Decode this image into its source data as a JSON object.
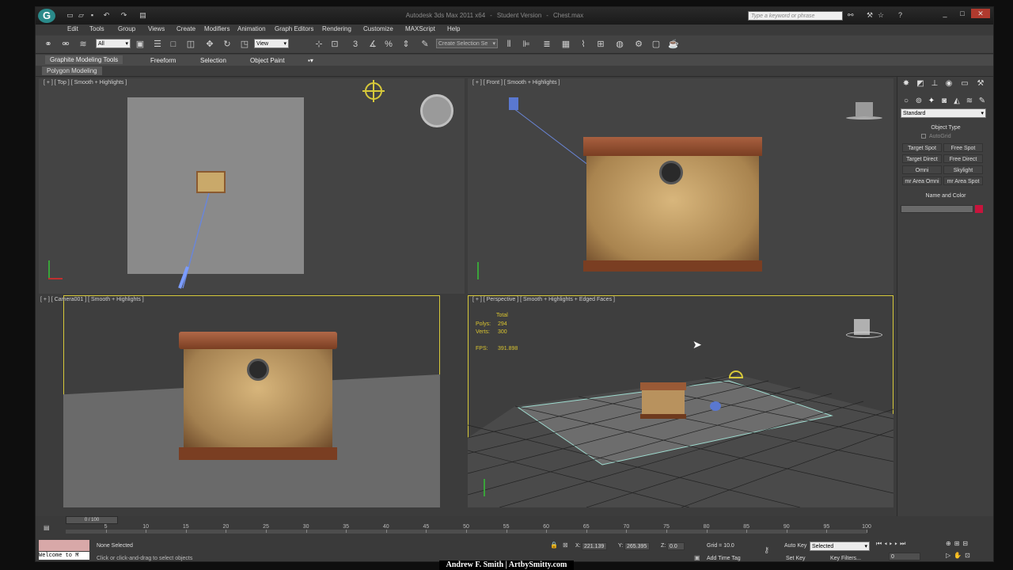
{
  "window": {
    "title_parts": [
      "Autodesk 3ds Max 2011 x64",
      "-",
      "Student Version",
      "-",
      "Chest.max"
    ],
    "search_placeholder": "Type a keyword or phrase",
    "controls": [
      "_",
      "□",
      "✕"
    ]
  },
  "menu": [
    "Edit",
    "Tools",
    "Group",
    "Views",
    "Create",
    "Modifiers",
    "Animation",
    "Graph Editors",
    "Rendering",
    "Customize",
    "MAXScript",
    "Help"
  ],
  "toolbar": {
    "filter_value": "All",
    "refcoord_value": "View",
    "selection_set_placeholder": "Create Selection Se"
  },
  "ribbon": {
    "tabs": [
      "Graphite Modeling Tools",
      "Freeform",
      "Selection",
      "Object Paint"
    ],
    "subtab": "Polygon Modeling"
  },
  "viewports": {
    "top": {
      "label": "[ + ] [ Top ] [ Smooth + Highlights ]"
    },
    "front": {
      "label": "[ + ] [ Front ] [ Smooth + Highlights ]"
    },
    "camera": {
      "label": "[ + ] [ Camera001 ] [ Smooth + Highlights ]"
    },
    "perspective": {
      "label": "[ + ] [ Perspective ] [ Smooth + Highlights + Edged Faces ]",
      "stats_total": "Total",
      "polys_label": "Polys:",
      "polys_value": "294",
      "verts_label": "Verts:",
      "verts_value": "300",
      "fps_label": "FPS:",
      "fps_value": "391.898"
    }
  },
  "command_panel": {
    "category_value": "Standard",
    "object_type_header": "Object Type",
    "autogrid_label": "AutoGrid",
    "buttons": [
      "Target Spot",
      "Free Spot",
      "Target Direct",
      "Free Direct",
      "Omni",
      "Skylight",
      "mr Area Omni",
      "mr Area Spot"
    ],
    "name_color_header": "Name and Color",
    "object_color": "#c8143c"
  },
  "timeline": {
    "frame_indicator": "0 / 100",
    "ticks": [
      "5",
      "10",
      "15",
      "20",
      "25",
      "30",
      "35",
      "40",
      "45",
      "50",
      "55",
      "60",
      "65",
      "70",
      "75",
      "80",
      "85",
      "90",
      "95",
      "100"
    ]
  },
  "status": {
    "maxscript_listener": "Welcome to M",
    "selection": "None Selected",
    "prompt": "Click or click-and-drag to select objects",
    "x_label": "X:",
    "x_value": "221.139",
    "y_label": "Y:",
    "y_value": "265.395",
    "z_label": "Z:",
    "z_value": "0.0",
    "grid": "Grid = 10.0",
    "add_time_tag": "Add Time Tag",
    "auto_key": "Auto Key",
    "set_key": "Set Key",
    "key_mode_value": "Selected",
    "key_filters": "Key Filters...",
    "current_frame": "0"
  },
  "credit": "Andrew F. Smith | ArtbySmitty.com",
  "colors": {
    "accent_selected": "#d7c93a",
    "logo": "#2a8a8a"
  }
}
